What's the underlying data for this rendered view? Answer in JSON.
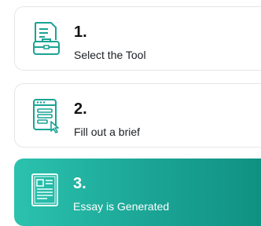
{
  "steps": [
    {
      "number": "1.",
      "label": "Select the Tool",
      "icon": "document-briefcase-icon",
      "active": false
    },
    {
      "number": "2.",
      "label": "Fill out a brief",
      "icon": "form-pointer-icon",
      "active": false
    },
    {
      "number": "3.",
      "label": "Essay is Generated",
      "icon": "essay-document-icon",
      "active": true
    }
  ],
  "colors": {
    "accent_start": "#2bc2ae",
    "accent_end": "#0f8f80",
    "icon_teal": "#1aa394",
    "border": "#e3e6ea"
  }
}
